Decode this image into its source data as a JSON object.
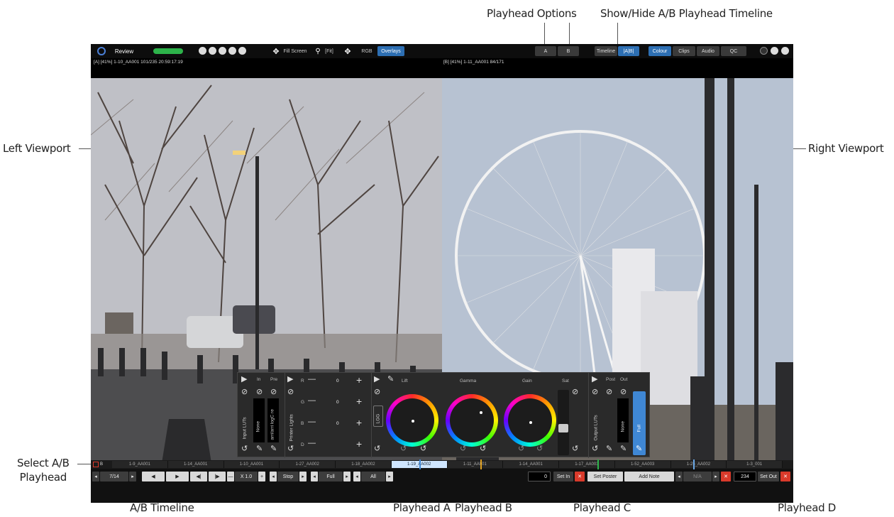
{
  "callouts": {
    "playhead_options": "Playhead Options",
    "show_hide": "Show/Hide A/B Playhead Timeline",
    "left_viewport": "Left Viewport",
    "right_viewport": "Right Viewport",
    "select_ab_line1": "Select A/B",
    "select_ab_line2": "Playhead",
    "ab_timeline": "A/B Timeline",
    "playhead_a": "Playhead A",
    "playhead_b": "Playhead B",
    "playhead_c": "Playhead C",
    "playhead_d": "Playhead D"
  },
  "topbar": {
    "app_title": "Review",
    "fill_screen": "Fill Screen",
    "fit": "[Fit]",
    "rgb": "RGB",
    "overlays": "Overlays",
    "playhead_a_btn": "A",
    "playhead_b_btn": "B",
    "timeline_btn": "Timeline",
    "ab_btn": "|A|B|",
    "colour": "Colour",
    "clips": "Clips",
    "audio": "Audio",
    "qc": "QC"
  },
  "info": {
    "left": "[A] [41%] 1-10_AA001  101/235  20:59:17:19",
    "right": "[B] [41%] 1-11_AA001  84/171"
  },
  "grading": {
    "input_luts": "Input LUTs",
    "in": "In",
    "pre": "Pre",
    "none": "None",
    "arri_logc": "arri/arri logC re",
    "printer_lights": "Printer Lights",
    "r": "R",
    "g": "G",
    "b": "B",
    "d": "D",
    "r_val": "0",
    "g_val": "0",
    "b_val": "0",
    "lgg": "LGG",
    "lift": "Lift",
    "gamma": "Gamma",
    "gain": "Gain",
    "sat": "Sat",
    "output_luts": "Output LUTs",
    "post": "Post",
    "out": "Out",
    "none2": "None",
    "full": "Full"
  },
  "timeline": {
    "selector": "B",
    "clips": [
      "1-9_AA001",
      "1-14_AA001",
      "1-10_AA001",
      "1-27_AA002",
      "1-18_AA002",
      "1-19_AA002",
      "1-11_AA001",
      "1-14_AA001",
      "1-17_AA003",
      "1-52_AA003",
      "1-25_AA002",
      "1-3_001"
    ],
    "selected_index": 5
  },
  "controls": {
    "clip_count": "7/14",
    "speed": "X 1.0",
    "loop": "Stop",
    "range": "Full",
    "scope": "All",
    "frame_in": "0",
    "set_in": "Set In",
    "set_poster": "Set Poster",
    "add_note": "Add Note",
    "note_nav": "N/A",
    "frame_out": "234",
    "set_out": "Set Out"
  },
  "colors": {
    "accent": "#2d6fb3",
    "status_green": "#2db34a",
    "danger": "#d93a2b",
    "selected_clip": "#cfe6ff"
  }
}
